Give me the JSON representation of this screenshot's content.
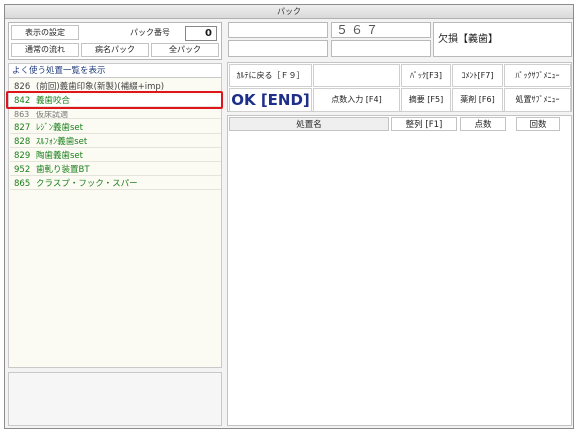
{
  "window": {
    "title": "パック"
  },
  "left_panel": {
    "display_settings_btn": "表示の設定",
    "pack_number_label": "パック番号",
    "pack_number_value": "0",
    "normal_flow_btn": "通常の流れ",
    "disease_pack_btn": "病名パック",
    "all_pack_btn": "全パック",
    "list_header": "よく使う処置一覧を表示",
    "items": [
      {
        "code": "826",
        "label": "(前回)義歯印象(新製)(補綴+imp)"
      },
      {
        "code": "842",
        "label": "義歯咬合"
      },
      {
        "code": "863",
        "label": "仮床試適"
      },
      {
        "code": "827",
        "label": "ﾚｼﾞﾝ義歯set"
      },
      {
        "code": "828",
        "label": "ｽﾙﾌｫﾝ義歯set"
      },
      {
        "code": "829",
        "label": "陶歯義歯set"
      },
      {
        "code": "952",
        "label": "歯軋り装置BT"
      },
      {
        "code": "865",
        "label": "クラスプ・フック・スパー"
      }
    ]
  },
  "right_panel": {
    "number_field": "５６７",
    "missing_label": "欠損【義歯】",
    "toolbar": {
      "back_to_karte": "ｶﾙﾃに戻る［Ｆ９］",
      "pack": "ﾊﾟｯｸ[F3]",
      "comment": "ｺﾒﾝﾄ[F7]",
      "pack_submenu": "ﾊﾟｯｸｻﾌﾞﾒﾆｭｰ",
      "ok": "OK [END]",
      "points_input": "点数入力 [F4]",
      "summary": "摘要 [F5]",
      "medicine": "薬剤 [F6]",
      "treatment_submenu": "処置ｻﾌﾞﾒﾆｭｰ"
    },
    "grid": {
      "col_name": "処置名",
      "col_sort": "整列 [F1]",
      "col_points": "点数",
      "col_count": "回数"
    }
  }
}
